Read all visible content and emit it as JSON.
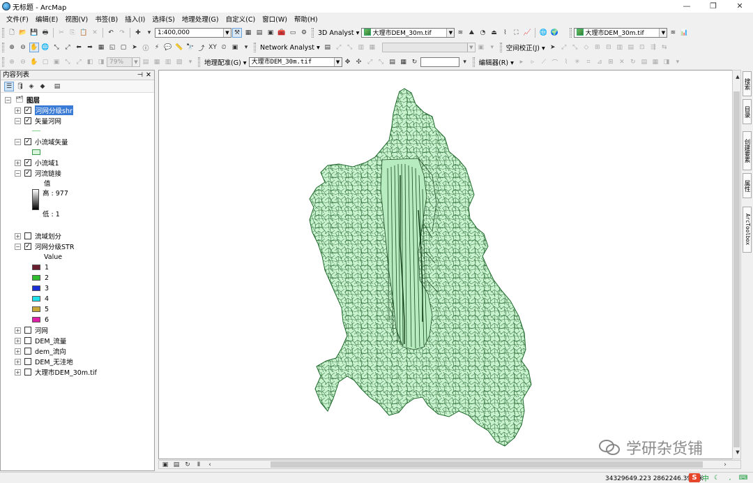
{
  "window": {
    "title": "无标题 - ArcMap",
    "controls": [
      "—",
      "❐",
      "✕"
    ]
  },
  "menu": [
    "文件(F)",
    "编辑(E)",
    "视图(V)",
    "书签(B)",
    "插入(I)",
    "选择(S)",
    "地理处理(G)",
    "自定义(C)",
    "窗口(W)",
    "帮助(H)"
  ],
  "toolbar1": {
    "scale": "1:400,000",
    "analyst_3d": "3D Analyst ▾",
    "layer_combo": "大理市DEM_30m.tif",
    "layer_combo2": "大理市DEM_30m.tif"
  },
  "toolbar2": {
    "network_analyst": "Network Analyst ▾",
    "spatial_adjust": "空间校正(J) ▾"
  },
  "toolbar3": {
    "zoom": "79%",
    "georef": "地理配准(G) ▾",
    "georef_layer": "大理市DEM_30m.tif",
    "editor": "编辑器(R) ▾"
  },
  "toc": {
    "title": "内容列表",
    "root": "图层",
    "layers": [
      {
        "name": "河网分级shr",
        "checked": "✓",
        "expand": "+"
      },
      {
        "name": "矢量河网",
        "checked": "✓",
        "expand": "−"
      },
      {
        "name": "小流域矢量",
        "checked": "✓",
        "expand": "−"
      },
      {
        "name": "小流域1",
        "checked": "✓",
        "expand": "+"
      },
      {
        "name": "河流链接",
        "checked": "✓",
        "expand": "−"
      },
      {
        "name": "流域划分",
        "checked": "",
        "expand": "+"
      },
      {
        "name": "河网分级STR",
        "checked": "✓",
        "expand": "−"
      },
      {
        "name": "河网",
        "checked": "",
        "expand": "+"
      },
      {
        "name": "DEM_流量",
        "checked": "",
        "expand": "+"
      },
      {
        "name": "dem_流向",
        "checked": "",
        "expand": "+"
      },
      {
        "name": "DEM_无洼地",
        "checked": "",
        "expand": "+"
      },
      {
        "name": "大理市DEM_30m.tif",
        "checked": "",
        "expand": "+"
      }
    ],
    "stream_link_legend": {
      "title": "值",
      "high": "高 : 977",
      "low": "低 : 1"
    },
    "str_legend": {
      "title": "Value",
      "classes": [
        {
          "label": "1",
          "color": "#6b1f2e"
        },
        {
          "label": "2",
          "color": "#2fbf2f"
        },
        {
          "label": "3",
          "color": "#1a2fd6"
        },
        {
          "label": "4",
          "color": "#1fe0e8"
        },
        {
          "label": "5",
          "color": "#c9a83a"
        },
        {
          "label": "6",
          "color": "#e01fa8"
        }
      ]
    }
  },
  "sidebar_tabs": [
    "搜索",
    "目录",
    "创建要素",
    "属性",
    "ArcToolbox"
  ],
  "status": {
    "coords": "34329649.223  2862246.399 米"
  },
  "ime": {
    "logo": "S",
    "lang": "中"
  },
  "watermark": "学研杂货铺",
  "colors": {
    "basin_fill": "#c9f2cf",
    "stream": "#1f6a2c",
    "selection": "#3a7bd5"
  }
}
